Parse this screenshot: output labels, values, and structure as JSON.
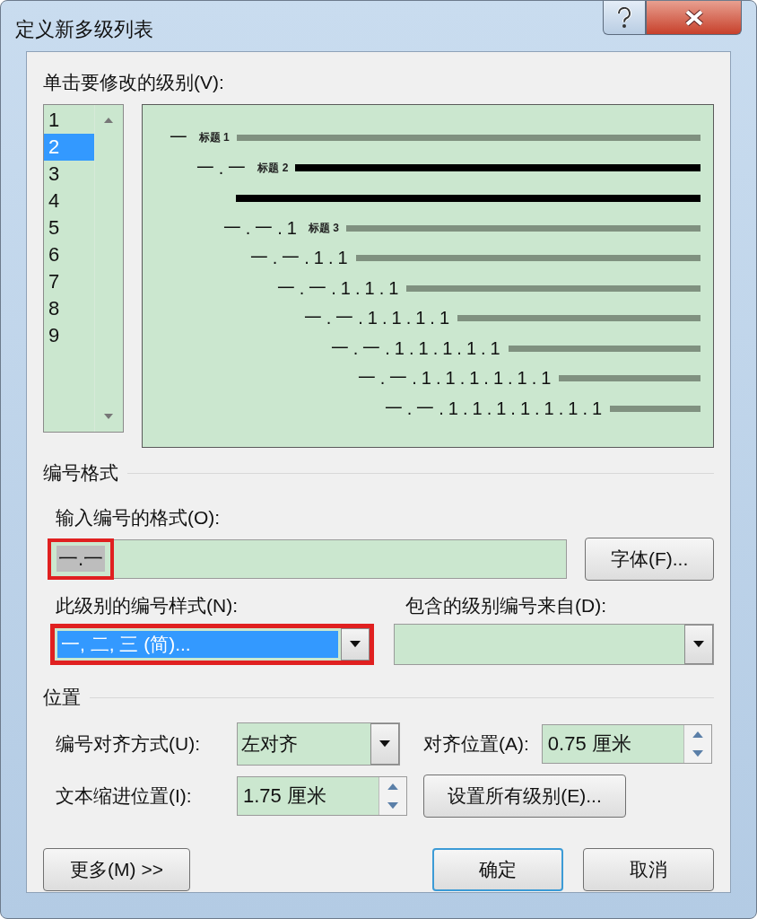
{
  "window": {
    "title": "定义新多级列表"
  },
  "level_picker": {
    "label": "单击要修改的级别(V):",
    "levels": [
      {
        "label": "1",
        "selected": false
      },
      {
        "label": "2",
        "selected": true
      },
      {
        "label": "3",
        "selected": false
      },
      {
        "label": "4",
        "selected": false
      },
      {
        "label": "5",
        "selected": false
      },
      {
        "label": "6",
        "selected": false
      },
      {
        "label": "7",
        "selected": false
      },
      {
        "label": "8",
        "selected": false
      },
      {
        "label": "9",
        "selected": false
      }
    ]
  },
  "preview": {
    "lines": [
      {
        "kind": "numbered",
        "number": "一",
        "caption": "标题 1",
        "selected": false
      },
      {
        "kind": "numbered",
        "number": "一.一",
        "caption": "标题 2",
        "selected": true
      },
      {
        "kind": "continuation",
        "selected": true
      },
      {
        "kind": "numbered",
        "number": "一.一.1",
        "caption": "标题 3",
        "selected": false
      },
      {
        "kind": "numbered",
        "number": "一.一.1.1",
        "selected": false
      },
      {
        "kind": "numbered",
        "number": "一.一.1.1.1",
        "selected": false
      },
      {
        "kind": "numbered",
        "number": "一.一.1.1.1.1",
        "selected": false
      },
      {
        "kind": "numbered",
        "number": "一.一.1.1.1.1.1",
        "selected": false
      },
      {
        "kind": "numbered",
        "number": "一.一.1.1.1.1.1.1",
        "selected": false
      },
      {
        "kind": "numbered",
        "number": "一.一.1.1.1.1.1.1.1",
        "selected": false
      }
    ]
  },
  "number_format": {
    "section": "编号格式",
    "format_label": "输入编号的格式(O):",
    "format_value": "一.一",
    "format_highlighted": true,
    "font_button": "字体(F)...",
    "style_label": "此级别的编号样式(N):",
    "style_value": "一, 二, 三 (简)...",
    "style_highlighted": true,
    "source_label": "包含的级别编号来自(D):"
  },
  "position": {
    "section": "位置",
    "align_label": "编号对齐方式(U):",
    "align_value": "左对齐",
    "at_label": "对齐位置(A):",
    "at_value": "0.75 厘米",
    "indent_label": "文本缩进位置(I):",
    "indent_value": "1.75 厘米",
    "set_all_button": "设置所有级别(E)..."
  },
  "buttons": [
    {
      "label": "更多(M) >>",
      "kind": "more"
    },
    {
      "label": "确定",
      "kind": "default"
    },
    {
      "label": "取消",
      "kind": "normal"
    }
  ]
}
